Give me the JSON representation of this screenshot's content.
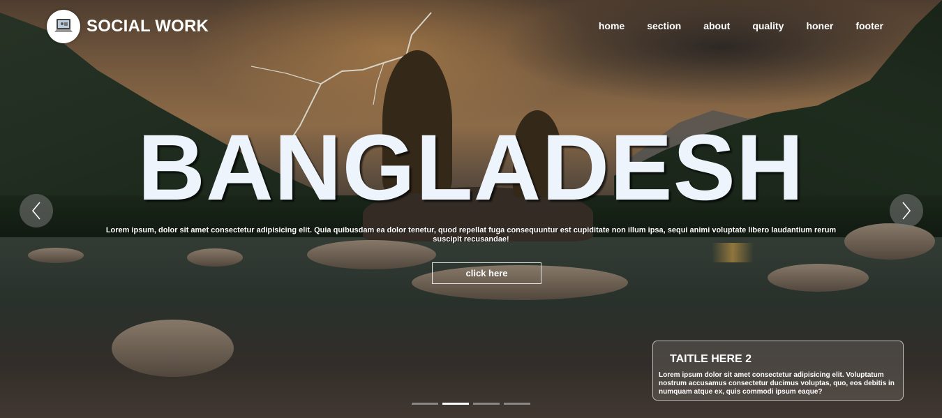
{
  "brand": {
    "name": "SOCIAL WORK",
    "logo_icon": "laptop-icon"
  },
  "nav": {
    "items": [
      {
        "label": "home"
      },
      {
        "label": "section"
      },
      {
        "label": "about"
      },
      {
        "label": "quality"
      },
      {
        "label": "honer"
      },
      {
        "label": "footer"
      }
    ]
  },
  "hero": {
    "headline": "BANGLADESH",
    "subtitle": "Lorem ipsum, dolor sit amet consectetur adipisicing elit. Quia quibusdam ea dolor tenetur, quod repellat fuga consequuntur est cupiditate non illum ipsa, sequi animi voluptate libero laudantium rerum suscipit recusandae!",
    "cta_label": "click here"
  },
  "carousel": {
    "prev_icon": "chevron-left-icon",
    "next_icon": "chevron-right-icon",
    "slide_count": 4,
    "active_index": 1
  },
  "caption": {
    "title": "TAITLE HERE 2",
    "text": "Lorem ipsum dolor sit amet consectetur adipisicing elit. Voluptatum nostrum accusamus consectetur ducimus voluptas, quo, eos debitis in numquam atque ex, quis commodi ipsum eaque?"
  },
  "colors": {
    "headline": "#eef4fb",
    "text": "#ffffff"
  }
}
